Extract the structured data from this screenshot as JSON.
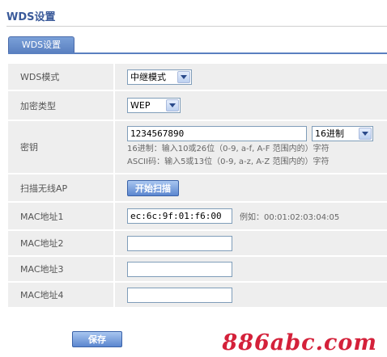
{
  "page": {
    "title": "WDS设置"
  },
  "tabs": [
    {
      "label": "WDS设置"
    }
  ],
  "form": {
    "wds_mode": {
      "label": "WDS模式",
      "value": "中继模式"
    },
    "encryption": {
      "label": "加密类型",
      "value": "WEP"
    },
    "key": {
      "label": "密钥",
      "value": "1234567890",
      "format": "16进制",
      "hint_hex": "16进制：输入10或26位（0-9, a-f, A-F 范围内的）字符",
      "hint_ascii": "ASCII码：输入5或13位（0-9, a-z, A-Z 范围内的）字符"
    },
    "scan": {
      "label": "扫描无线AP",
      "button": "开始扫描"
    },
    "mac1": {
      "label": "MAC地址1",
      "value": "ec:6c:9f:01:f6:00",
      "example": "例如：00:01:02:03:04:05"
    },
    "mac2": {
      "label": "MAC地址2",
      "value": ""
    },
    "mac3": {
      "label": "MAC地址3",
      "value": ""
    },
    "mac4": {
      "label": "MAC地址4",
      "value": ""
    }
  },
  "save_button": "保存",
  "watermark": "886abc.com"
}
